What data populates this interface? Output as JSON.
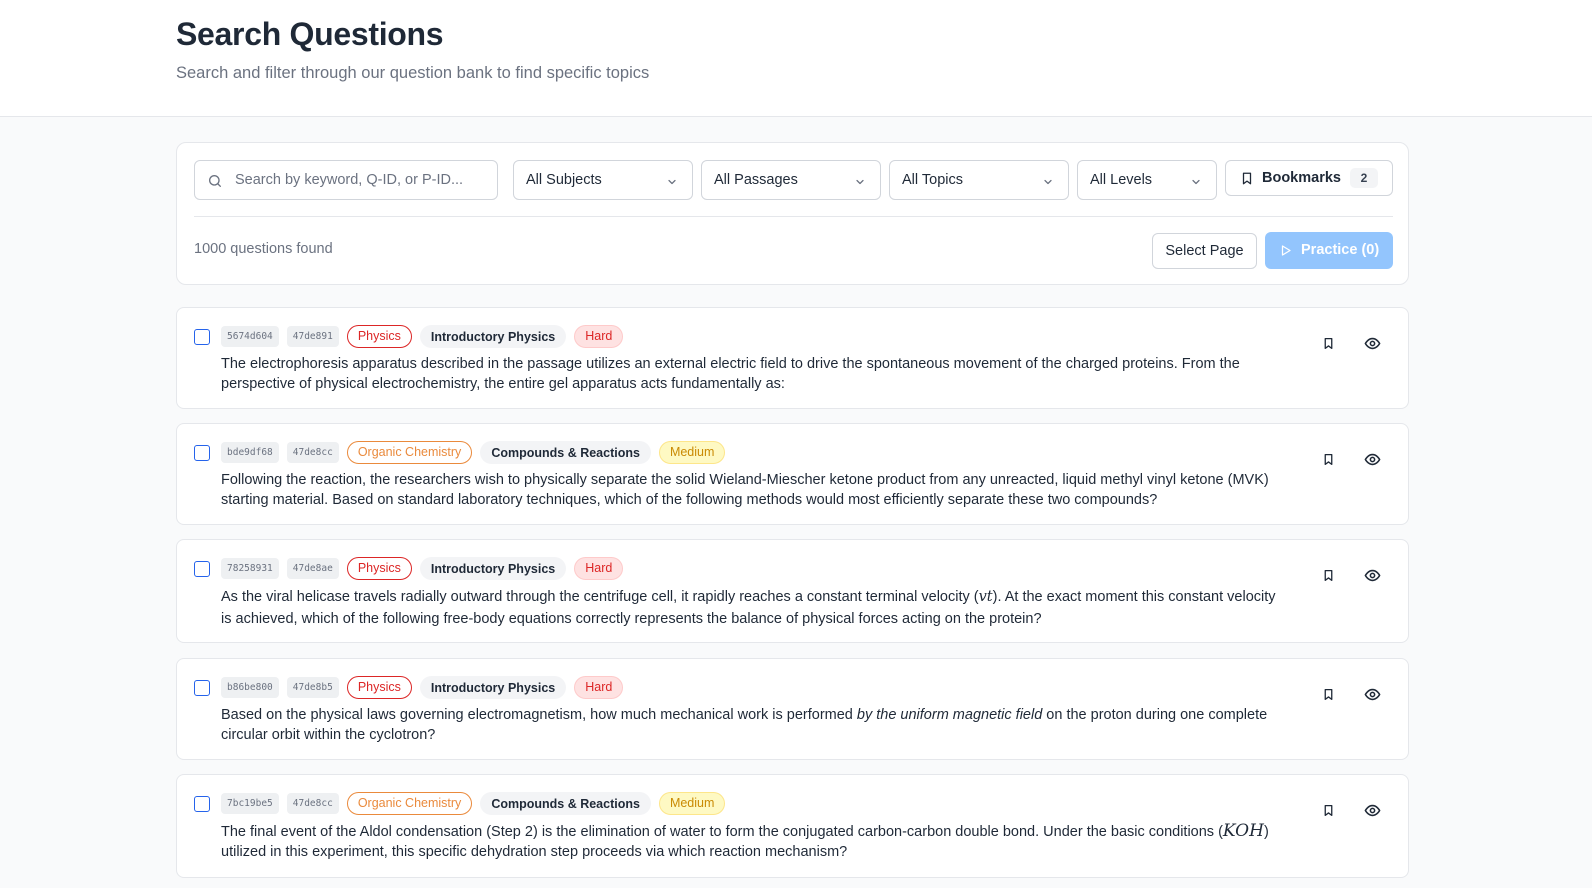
{
  "header": {
    "title": "Search Questions",
    "subtitle": "Search and filter through our question bank to find specific topics"
  },
  "filters": {
    "search_placeholder": "Search by keyword, Q-ID, or P-ID...",
    "subjects": "All Subjects",
    "passages": "All Passages",
    "topics": "All Topics",
    "levels": "All Levels",
    "bookmarks_label": "Bookmarks",
    "bookmarks_count": "2",
    "results_count": "1000 questions found",
    "select_page": "Select Page",
    "practice": "Practice (0)"
  },
  "colors": {
    "accent_disabled": "#93c5fd",
    "physics": "#dc2626",
    "organic_chemistry": "#ea8a3c",
    "hard": "#dc2626",
    "medium": "#ca8a04"
  },
  "questions": [
    {
      "qid": "5674d604",
      "pid": "47de891",
      "subject": "Physics",
      "topic": "Introductory Physics",
      "level": "Hard",
      "text": "The electrophoresis apparatus described in the passage utilizes an external electric field to drive the spontaneous movement of the charged proteins. From the perspective of physical electrochemistry, the entire gel apparatus acts fundamentally as:"
    },
    {
      "qid": "bde9df68",
      "pid": "47de8cc",
      "subject": "Organic Chemistry",
      "topic": "Compounds & Reactions",
      "level": "Medium",
      "text": "Following the reaction, the researchers wish to physically separate the solid Wieland-Miescher ketone product from any unreacted, liquid methyl vinyl ketone (MVK) starting material. Based on standard laboratory techniques, which of the following methods would most efficiently separate these two compounds?"
    },
    {
      "qid": "78258931",
      "pid": "47de8ae",
      "subject": "Physics",
      "topic": "Introductory Physics",
      "level": "Hard",
      "text_a": "As the viral helicase travels radially outward through the centrifuge cell, it rapidly reaches a constant terminal velocity (",
      "text_math": "vt",
      "text_b": "). At the exact moment this constant velocity is achieved, which of the following free-body equations correctly represents the balance of physical forces acting on the protein?"
    },
    {
      "qid": "b86be800",
      "pid": "47de8b5",
      "subject": "Physics",
      "topic": "Introductory Physics",
      "level": "Hard",
      "text_a": "Based on the physical laws governing electromagnetism, how much mechanical work is performed ",
      "text_em": "by the uniform magnetic field",
      "text_b": " on the proton during one complete circular orbit within the cyclotron?"
    },
    {
      "qid": "7bc19be5",
      "pid": "47de8cc",
      "subject": "Organic Chemistry",
      "topic": "Compounds & Reactions",
      "level": "Medium",
      "text_a": "The final event of the Aldol condensation (Step 2) is the elimination of water to form the conjugated carbon-carbon double bond. Under the basic conditions (",
      "text_math": "KOH",
      "text_b": ") utilized in this experiment, this specific dehydration step proceeds via which reaction mechanism?"
    }
  ]
}
